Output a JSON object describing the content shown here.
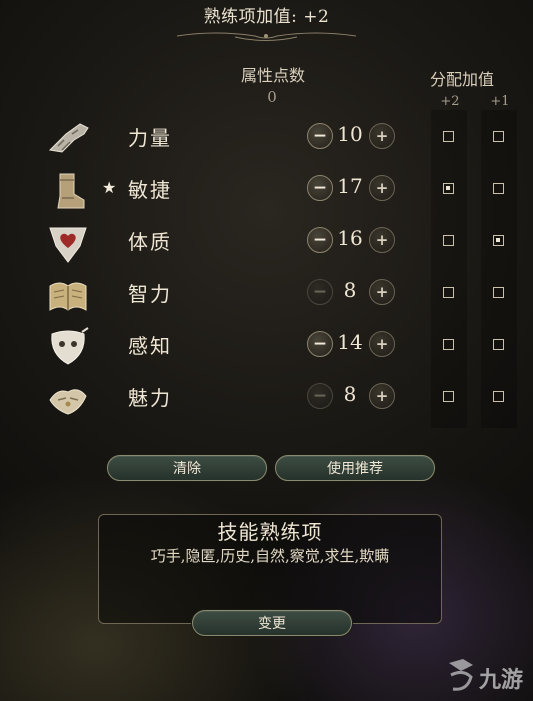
{
  "header": {
    "title": "熟练项加值: +2"
  },
  "columns": {
    "attributes_label": "属性点数",
    "points_remaining": "0",
    "bonus_label": "分配加值",
    "bonus_plus2": "+2",
    "bonus_plus1": "+1"
  },
  "abilities": [
    {
      "name": "力量",
      "value": "10",
      "starred": false,
      "minus_enabled": true,
      "bonus2": false,
      "bonus1": false,
      "icon": "gauntlet-icon"
    },
    {
      "name": "敏捷",
      "value": "17",
      "starred": true,
      "minus_enabled": true,
      "bonus2": true,
      "bonus1": false,
      "icon": "boot-icon"
    },
    {
      "name": "体质",
      "value": "16",
      "starred": false,
      "minus_enabled": true,
      "bonus2": false,
      "bonus1": true,
      "icon": "heart-shield-icon"
    },
    {
      "name": "智力",
      "value": "8",
      "starred": false,
      "minus_enabled": false,
      "bonus2": false,
      "bonus1": false,
      "icon": "book-icon"
    },
    {
      "name": "感知",
      "value": "14",
      "starred": false,
      "minus_enabled": true,
      "bonus2": false,
      "bonus1": false,
      "icon": "mask-icon"
    },
    {
      "name": "魅力",
      "value": "8",
      "starred": false,
      "minus_enabled": false,
      "bonus2": false,
      "bonus1": false,
      "icon": "hands-icon"
    }
  ],
  "star_symbol": "★",
  "minus_symbol": "−",
  "plus_symbol": "+",
  "buttons": {
    "clear": "清除",
    "recommend": "使用推荐",
    "change": "变更"
  },
  "skills": {
    "title": "技能熟练项",
    "list": "巧手,隐匿,历史,自然,察觉,求生,欺瞒"
  },
  "watermark": {
    "text": "九游",
    "icon": "jiuyou-logo-icon"
  }
}
